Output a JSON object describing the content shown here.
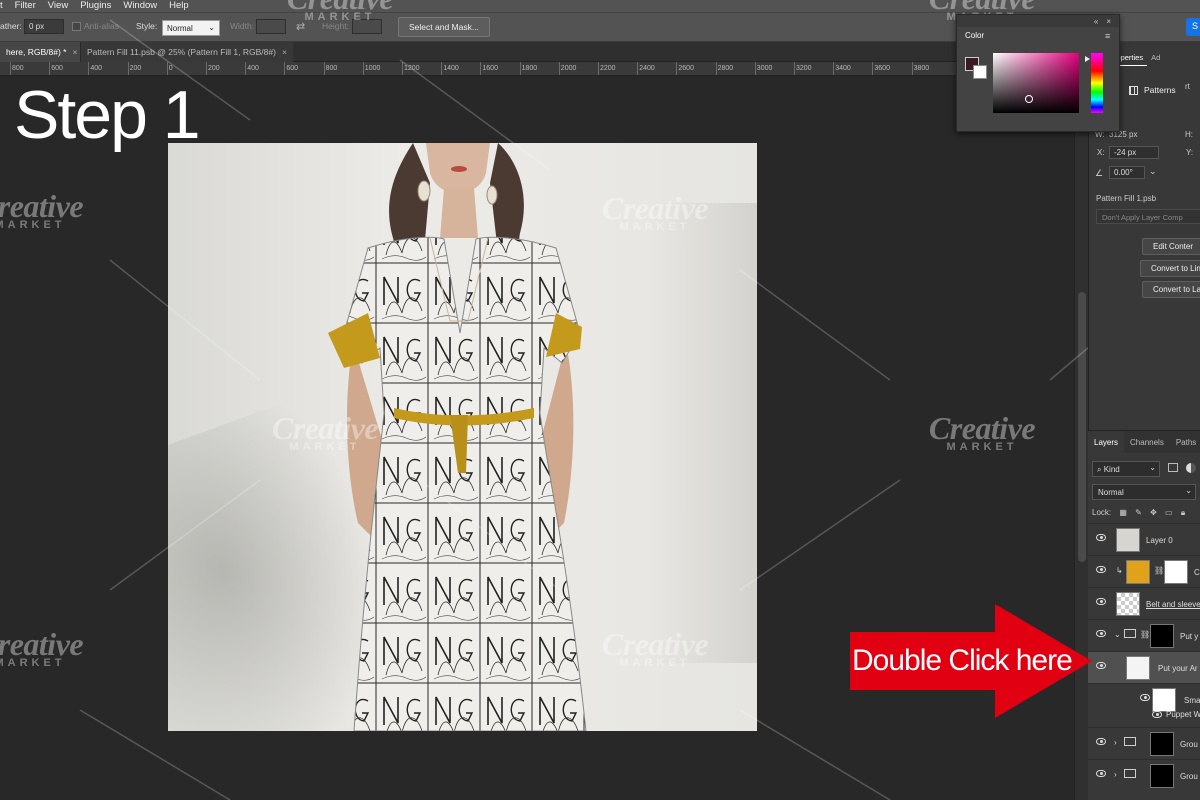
{
  "menu": [
    "t",
    "Filter",
    "View",
    "Plugins",
    "Window",
    "Help"
  ],
  "options": {
    "feather_label": "ather:",
    "feather_value": "0 px",
    "antialias_label": "Anti-alias",
    "style_label": "Style:",
    "style_value": "Normal",
    "width_label": "Width:",
    "height_label": "Height:",
    "select_mask_label": "Select and Mask...",
    "share_label": "S"
  },
  "tabs": [
    {
      "label": "here, RGB/8#) *",
      "active": true
    },
    {
      "label": "Pattern Fill 11.psb @ 25% (Pattern Fill 1, RGB/8#)",
      "active": false
    }
  ],
  "ruler": [
    "800",
    "600",
    "400",
    "200",
    "0",
    "200",
    "400",
    "600",
    "800",
    "1000",
    "1200",
    "1400",
    "1600",
    "1800",
    "2000",
    "2200",
    "2400",
    "2600",
    "2800",
    "3000",
    "3200",
    "3400",
    "3600",
    "3800"
  ],
  "step_title": "Step 1",
  "callout": "Double Click here",
  "watermark": {
    "big": "Creative",
    "small": "MARKET"
  },
  "color_panel": {
    "title": "Color",
    "fg_color": "#3a1a25",
    "hue_color": "#e5007e"
  },
  "properties": {
    "tabs": [
      "es",
      "Properties",
      "Ad"
    ],
    "partial_right": "rt",
    "patterns_label": "Patterns",
    "section": "orm",
    "w_label": "W:",
    "w_value": "3125 px",
    "x_label": "X:",
    "x_value": "-24 px",
    "h_label": "H:",
    "y_label": "Y:",
    "angle_value": "0.00°",
    "file_label": "Pattern Fill 1.psb",
    "layer_comp": "Don't Apply Layer Comp",
    "buttons": [
      "Edit Conter",
      "Convert to Linl",
      "Convert to La"
    ]
  },
  "layers": {
    "tabs": [
      "Layers",
      "Channels",
      "Paths"
    ],
    "kind": "Kind",
    "blend": "Normal",
    "lock": "Lock:",
    "rows": [
      {
        "name": "Layer 0"
      },
      {
        "name": "C"
      },
      {
        "name": "Belt and sleeves"
      },
      {
        "name": "Put y"
      },
      {
        "name": "Put your Ar"
      },
      {
        "name": "Sma"
      },
      {
        "name": "Puppet W"
      },
      {
        "name": "Grou"
      },
      {
        "name": "Grou"
      }
    ]
  }
}
